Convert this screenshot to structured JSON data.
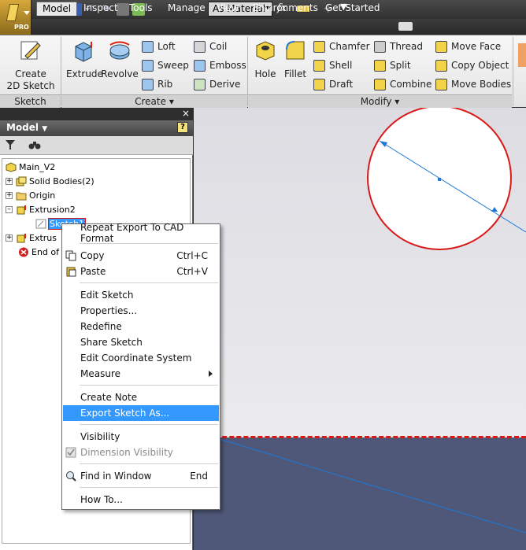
{
  "quick_access": {
    "material": "As Material",
    "fx": "fx"
  },
  "tabs": [
    {
      "label": "Model",
      "active": true
    },
    {
      "label": "Inspect"
    },
    {
      "label": "Tools"
    },
    {
      "label": "Manage"
    },
    {
      "label": "View"
    },
    {
      "label": "Environments"
    },
    {
      "label": "Get Started"
    }
  ],
  "ribbon": {
    "sketch_panel": {
      "create_sketch_1": "Create",
      "create_sketch_2": "2D Sketch",
      "footer": "Sketch"
    },
    "create_panel": {
      "extrude": "Extrude",
      "revolve": "Revolve",
      "loft": "Loft",
      "sweep": "Sweep",
      "rib": "Rib",
      "coil": "Coil",
      "emboss": "Emboss",
      "derive": "Derive",
      "footer": "Create"
    },
    "modify_panel": {
      "hole": "Hole",
      "fillet": "Fillet",
      "chamfer": "Chamfer",
      "shell": "Shell",
      "draft": "Draft",
      "thread": "Thread",
      "split": "Split",
      "combine": "Combine",
      "move_face": "Move Face",
      "copy_object": "Copy Object",
      "move_bodies": "Move Bodies",
      "footer": "Modify"
    }
  },
  "browser": {
    "title": "Model",
    "help": "?",
    "close": "×",
    "tree": [
      {
        "label": "Main_V2"
      },
      {
        "label": "Solid Bodies(2)"
      },
      {
        "label": "Origin"
      },
      {
        "label": "Extrusion2"
      },
      {
        "label": "Sketch1"
      },
      {
        "label": "Extrus"
      },
      {
        "label": "End of"
      }
    ]
  },
  "context_menu": {
    "items": [
      {
        "label": "Repeat Export To CAD Format"
      },
      {
        "label": "Copy",
        "shortcut": "Ctrl+C"
      },
      {
        "label": "Paste",
        "shortcut": "Ctrl+V"
      },
      {
        "label": "Edit Sketch"
      },
      {
        "label": "Properties..."
      },
      {
        "label": "Redefine"
      },
      {
        "label": "Share Sketch"
      },
      {
        "label": "Edit Coordinate System"
      },
      {
        "label": "Measure"
      },
      {
        "label": "Create Note"
      },
      {
        "label": "Export Sketch As..."
      },
      {
        "label": "Visibility"
      },
      {
        "label": "Dimension Visibility"
      },
      {
        "label": "Find in Window",
        "shortcut": "End"
      },
      {
        "label": "How To..."
      }
    ]
  },
  "colors": {
    "highlight": "#3399ff",
    "sketch_red": "#d91818",
    "sketch_blue": "#1f78d6"
  }
}
